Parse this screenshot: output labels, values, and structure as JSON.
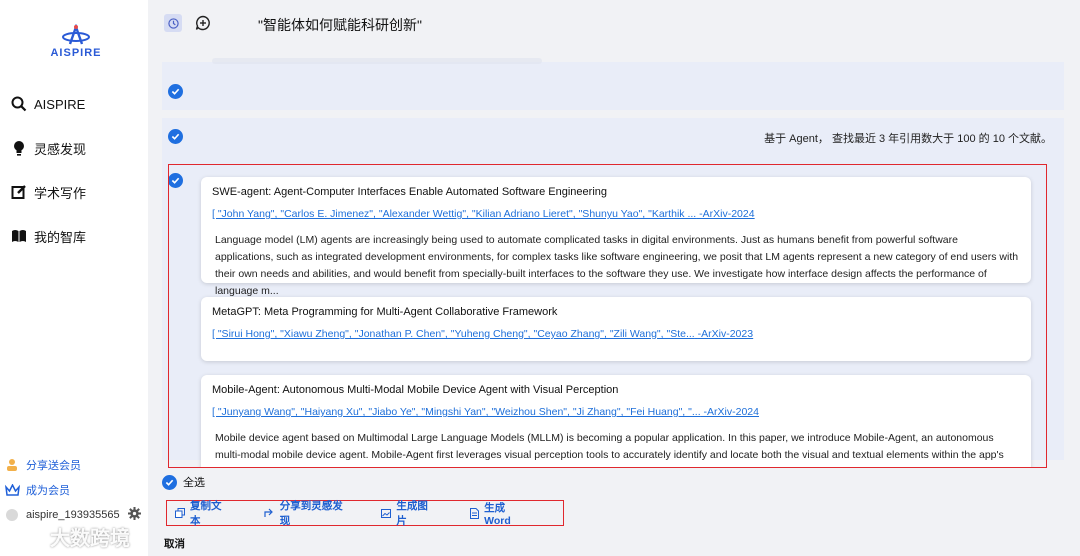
{
  "sidebar": {
    "logo_text": "AISPIRE",
    "nav": [
      {
        "label": "AISPIRE",
        "icon": "search-icon"
      },
      {
        "label": "灵感发现",
        "icon": "lightbulb-icon"
      },
      {
        "label": "学术写作",
        "icon": "pencil-icon"
      },
      {
        "label": "我的智库",
        "icon": "book-icon"
      }
    ],
    "share_label": "分享送会员",
    "member_label": "成为会员",
    "username": "aispire_193935565"
  },
  "topbar": {
    "title": "\"智能体如何赋能科研创新\""
  },
  "query": "基于 Agent， 查找最近 3 年引用数大于 100 的 10 个文献。",
  "papers": [
    {
      "title": "SWE-agent: Agent-Computer Interfaces Enable Automated Software Engineering",
      "authors": "[ \"John Yang\", \"Carlos E. Jimenez\", \"Alexander Wettig\", \"Kilian Adriano Lieret\", \"Shunyu Yao\", \"Karthik ...",
      "source": "-ArXiv-2024",
      "abstract": "Language model (LM) agents are increasingly being used to automate complicated tasks in digital environments. Just as humans benefit from powerful software applications, such as integrated development environments, for complex tasks like software engineering, we posit that LM agents represent a new category of end users with their own needs and abilities, and would benefit from specially-built interfaces to the software they use. We investigate how interface design affects the performance of language m..."
    },
    {
      "title": "MetaGPT: Meta Programming for Multi-Agent Collaborative Framework",
      "authors": "[ \"Sirui Hong\", \"Xiawu Zheng\", \"Jonathan P. Chen\", \"Yuheng Cheng\", \"Ceyao Zhang\", \"Zili Wang\", \"Ste...",
      "source": "-ArXiv-2023",
      "abstract": ""
    },
    {
      "title": "Mobile-Agent: Autonomous Multi-Modal Mobile Device Agent with Visual Perception",
      "authors": "[ \"Junyang Wang\", \"Haiyang Xu\", \"Jiabo Ye\", \"Mingshi Yan\", \"Weizhou Shen\", \"Ji Zhang\", \"Fei Huang\", \"...",
      "source": "-ArXiv-2024",
      "abstract": "Mobile device agent based on Multimodal Large Language Models (MLLM) is becoming a popular application. In this paper, we introduce Mobile-Agent, an autonomous multi-modal mobile device agent. Mobile-Agent first leverages visual perception tools to accurately identify and locate both the visual and textual elements within the app's front"
    }
  ],
  "select_all_label": "全选",
  "actions": [
    {
      "label": "复制文本",
      "icon": "copy-icon"
    },
    {
      "label": "分享到灵感发现",
      "icon": "share-icon"
    },
    {
      "label": "生成图片",
      "icon": "image-icon"
    },
    {
      "label": "生成Word",
      "icon": "word-doc-icon"
    }
  ],
  "cancel_label": "取消",
  "watermark": "大数跨境",
  "colors": {
    "accent": "#1f6fe0",
    "highlight_border": "#e0282e",
    "panel_bg": "#e9edf8"
  }
}
